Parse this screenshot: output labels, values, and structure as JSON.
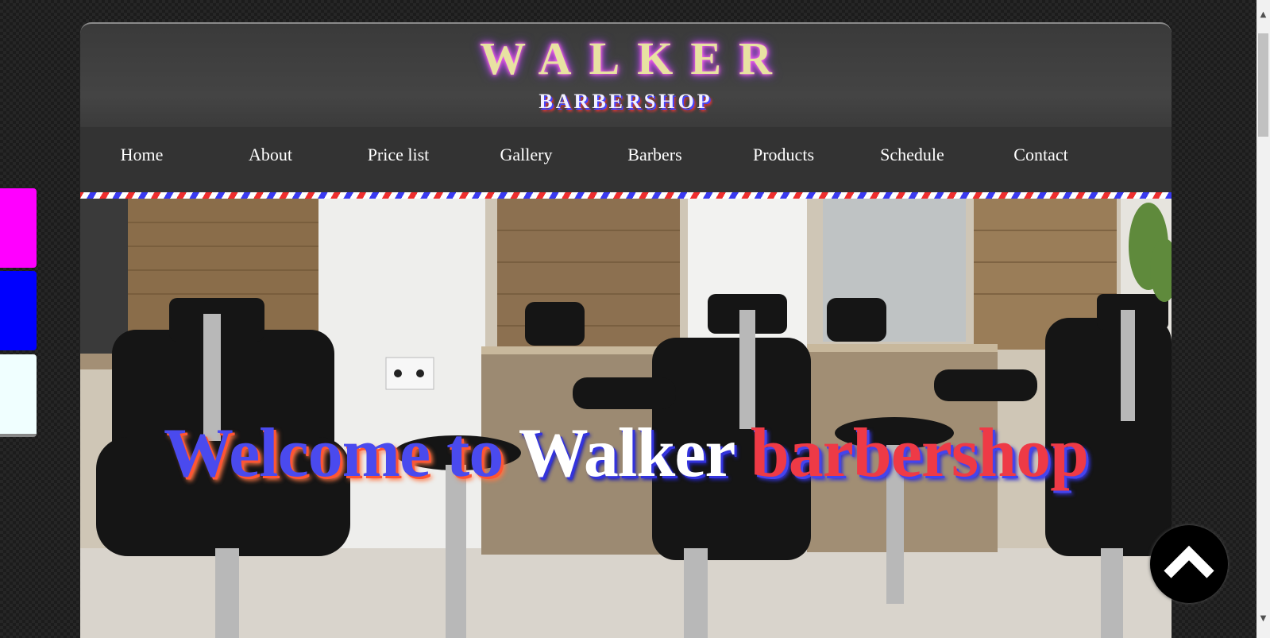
{
  "header": {
    "logo_title": "WALKER",
    "logo_subtitle": "BARBERSHOP"
  },
  "nav": {
    "items": [
      {
        "label": "Home"
      },
      {
        "label": "About"
      },
      {
        "label": "Price list"
      },
      {
        "label": "Gallery"
      },
      {
        "label": "Barbers"
      },
      {
        "label": "Products"
      },
      {
        "label": "Schedule"
      },
      {
        "label": "Contact"
      }
    ]
  },
  "hero": {
    "welcome_part1": "Welcome to",
    "welcome_part2": "Walker",
    "welcome_part3": "barbershop"
  },
  "theme_swatches": [
    {
      "color": "#ff00ff"
    },
    {
      "color": "#0000ff"
    },
    {
      "color": "#f0ffff"
    }
  ],
  "back_to_top": {
    "icon": "chevron-up-icon"
  },
  "colors": {
    "accent_blue": "#4a4aee",
    "accent_red": "#ee3a46",
    "logo_gold": "#e8e2a2",
    "nav_bg": "#333333"
  }
}
